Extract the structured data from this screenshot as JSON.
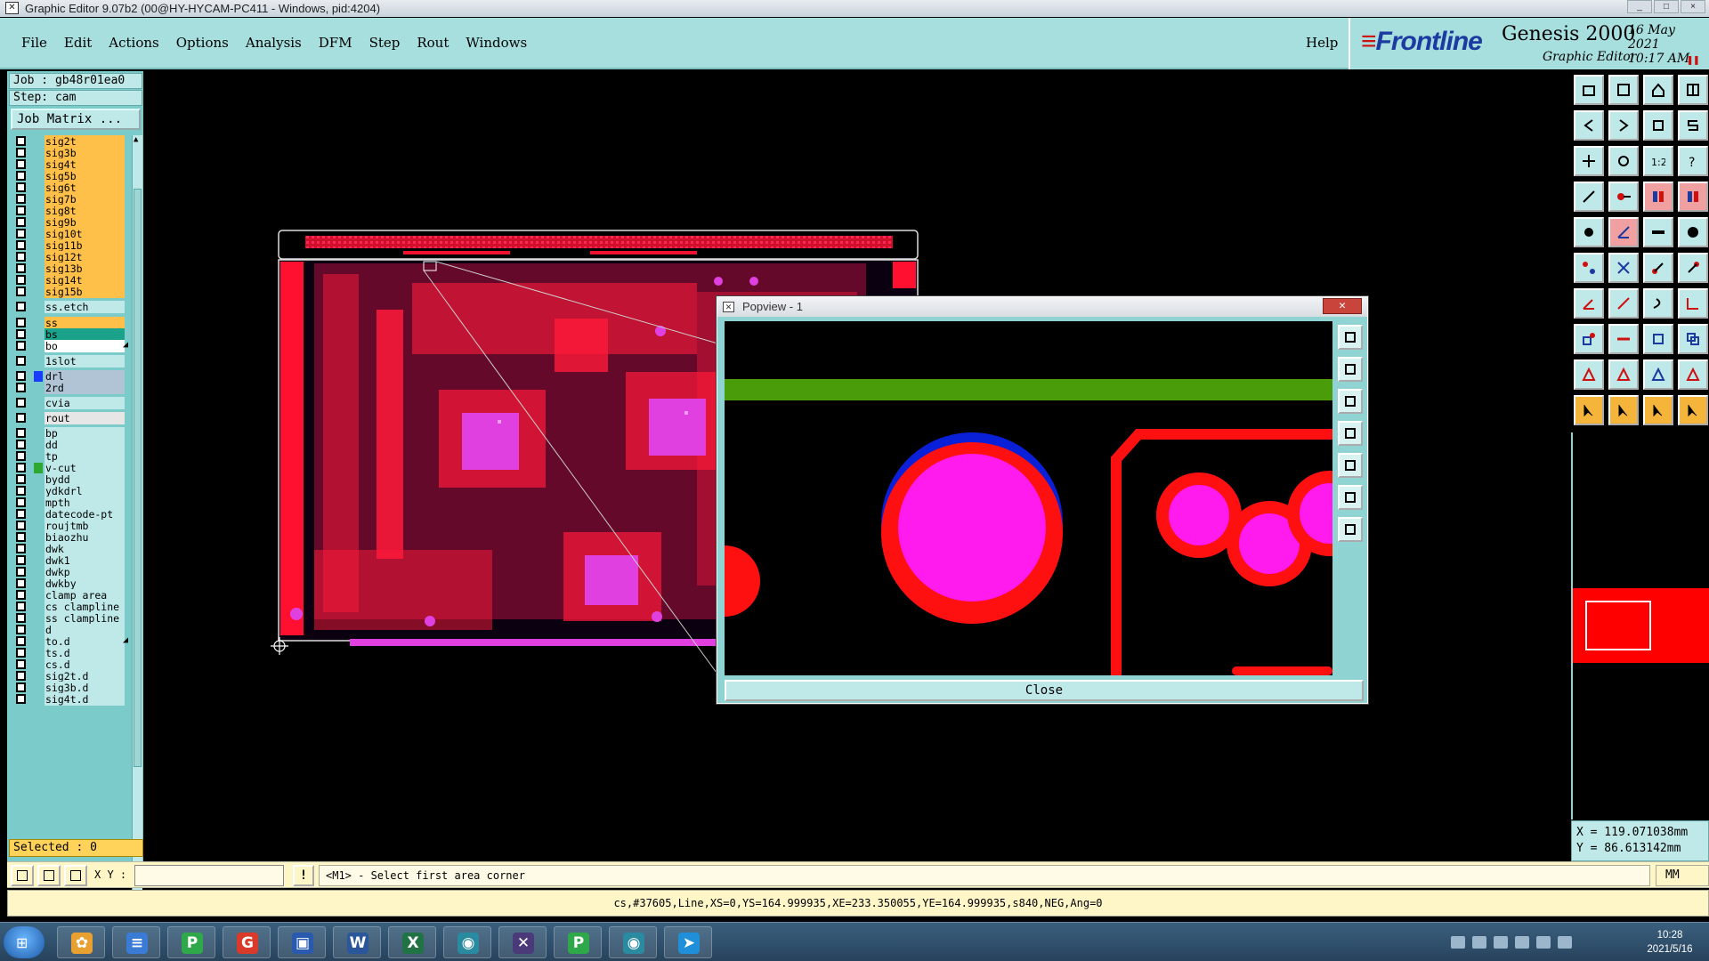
{
  "window": {
    "title": "Graphic Editor 9.07b2 (00@HY-HYCAM-PC411 - Windows, pid:4204)"
  },
  "menu": {
    "items": [
      "File",
      "Edit",
      "Actions",
      "Options",
      "Analysis",
      "DFM",
      "Step",
      "Rout",
      "Windows"
    ],
    "help": "Help"
  },
  "brand": {
    "logo": "Frontline",
    "product": "Genesis 2000",
    "subtitle": "Graphic Editor",
    "date": "16 May 2021",
    "time": "10:17 AM"
  },
  "job": {
    "job_label": "Job : gb48r01ea0",
    "step_label": "Step: cam",
    "matrix_button": "Job Matrix ..."
  },
  "layers": [
    {
      "name": "sig2t",
      "color": "#ffc04a"
    },
    {
      "name": "sig3b",
      "color": "#ffc04a"
    },
    {
      "name": "sig4t",
      "color": "#ffc04a"
    },
    {
      "name": "sig5b",
      "color": "#ffc04a"
    },
    {
      "name": "sig6t",
      "color": "#ffc04a"
    },
    {
      "name": "sig7b",
      "color": "#ffc04a"
    },
    {
      "name": "sig8t",
      "color": "#ffc04a"
    },
    {
      "name": "sig9b",
      "color": "#ffc04a"
    },
    {
      "name": "sig10t",
      "color": "#ffc04a"
    },
    {
      "name": "sig11b",
      "color": "#ffc04a"
    },
    {
      "name": "sig12t",
      "color": "#ffc04a"
    },
    {
      "name": "sig13b",
      "color": "#ffc04a"
    },
    {
      "name": "sig14t",
      "color": "#ffc04a"
    },
    {
      "name": "sig15b",
      "color": "#ffc04a"
    },
    {
      "name": "ss.etch",
      "color": "#bfe8e8"
    },
    {
      "name": "ss",
      "color": "#ffc04a"
    },
    {
      "name": "bs",
      "color": "#1aa38a"
    },
    {
      "name": "bo",
      "color": "#ffffff",
      "mark": "◢"
    },
    {
      "name": "1slot",
      "color": "#bfe8e8"
    },
    {
      "name": "drl",
      "color": "#b0c4d6",
      "swatch": "#1a3cff"
    },
    {
      "name": "2rd",
      "color": "#b0c4d6"
    },
    {
      "name": "cvia",
      "color": "#bfe8e8"
    },
    {
      "name": "rout",
      "color": "#e6e6e6"
    },
    {
      "name": "bp",
      "color": "#bfe8e8"
    },
    {
      "name": "dd",
      "color": "#bfe8e8"
    },
    {
      "name": "tp",
      "color": "#bfe8e8"
    },
    {
      "name": "v-cut",
      "color": "#bfe8e8",
      "swatch": "#2ea82e"
    },
    {
      "name": "bydd",
      "color": "#bfe8e8"
    },
    {
      "name": "ydkdrl",
      "color": "#bfe8e8"
    },
    {
      "name": "mpth",
      "color": "#bfe8e8"
    },
    {
      "name": "datecode-pt",
      "color": "#bfe8e8"
    },
    {
      "name": "roujtmb",
      "color": "#bfe8e8"
    },
    {
      "name": "biaozhu",
      "color": "#bfe8e8"
    },
    {
      "name": "dwk",
      "color": "#bfe8e8"
    },
    {
      "name": "dwk1",
      "color": "#bfe8e8"
    },
    {
      "name": "dwkp",
      "color": "#bfe8e8"
    },
    {
      "name": "dwkby",
      "color": "#bfe8e8"
    },
    {
      "name": "clamp_area",
      "color": "#bfe8e8"
    },
    {
      "name": "cs_clampline",
      "color": "#bfe8e8"
    },
    {
      "name": "ss_clampline",
      "color": "#bfe8e8"
    },
    {
      "name": "d",
      "color": "#bfe8e8"
    },
    {
      "name": "to.d",
      "color": "#bfe8e8",
      "mark": "◢"
    },
    {
      "name": "ts.d",
      "color": "#bfe8e8"
    },
    {
      "name": "cs.d",
      "color": "#bfe8e8"
    },
    {
      "name": "sig2t.d",
      "color": "#bfe8e8"
    },
    {
      "name": "sig3b.d",
      "color": "#bfe8e8"
    },
    {
      "name": "sig4t.d",
      "color": "#bfe8e8"
    }
  ],
  "selected": "Selected : 0",
  "popview": {
    "title": "Popview - 1",
    "close_label": "Close"
  },
  "coords": {
    "x": "X = 119.071038mm",
    "y": "Y =  86.613142mm"
  },
  "command": {
    "xy_label": "X Y :",
    "xy_value": "",
    "warn": "!",
    "prompt": "<M1> - Select first area corner",
    "units": "MM"
  },
  "status_line": "cs,#37605,Line,XS=0,YS=164.999935,XE=233.350055,YE=164.999935,s840,NEG,Ang=0",
  "taskbar": {
    "apps": [
      {
        "icon": "sunflower-app-icon",
        "glyph": "✿",
        "bg": "#e8a030"
      },
      {
        "icon": "notepad-icon",
        "glyph": "≡",
        "bg": "#3a7bd5"
      },
      {
        "icon": "p-app-icon",
        "glyph": "P",
        "bg": "#2fa84a"
      },
      {
        "icon": "g-app-icon",
        "glyph": "G",
        "bg": "#d93a2a"
      },
      {
        "icon": "floppy-save-icon",
        "glyph": "▣",
        "bg": "#2a5ab0"
      },
      {
        "icon": "word-icon",
        "glyph": "W",
        "bg": "#2b579a"
      },
      {
        "icon": "excel-icon",
        "glyph": "X",
        "bg": "#217346"
      },
      {
        "icon": "eye-app-icon",
        "glyph": "◉",
        "bg": "#2a8aa0"
      },
      {
        "icon": "x-app-icon",
        "glyph": "✕",
        "bg": "#4a3a7a"
      },
      {
        "icon": "p-app-icon-2",
        "glyph": "P",
        "bg": "#2fa84a"
      },
      {
        "icon": "eye-app-icon-2",
        "glyph": "◉",
        "bg": "#2a8aa0"
      },
      {
        "icon": "send-app-icon",
        "glyph": "➤",
        "bg": "#1e8fd8"
      }
    ],
    "clock_time": "10:28",
    "clock_date": "2021/5/16"
  }
}
